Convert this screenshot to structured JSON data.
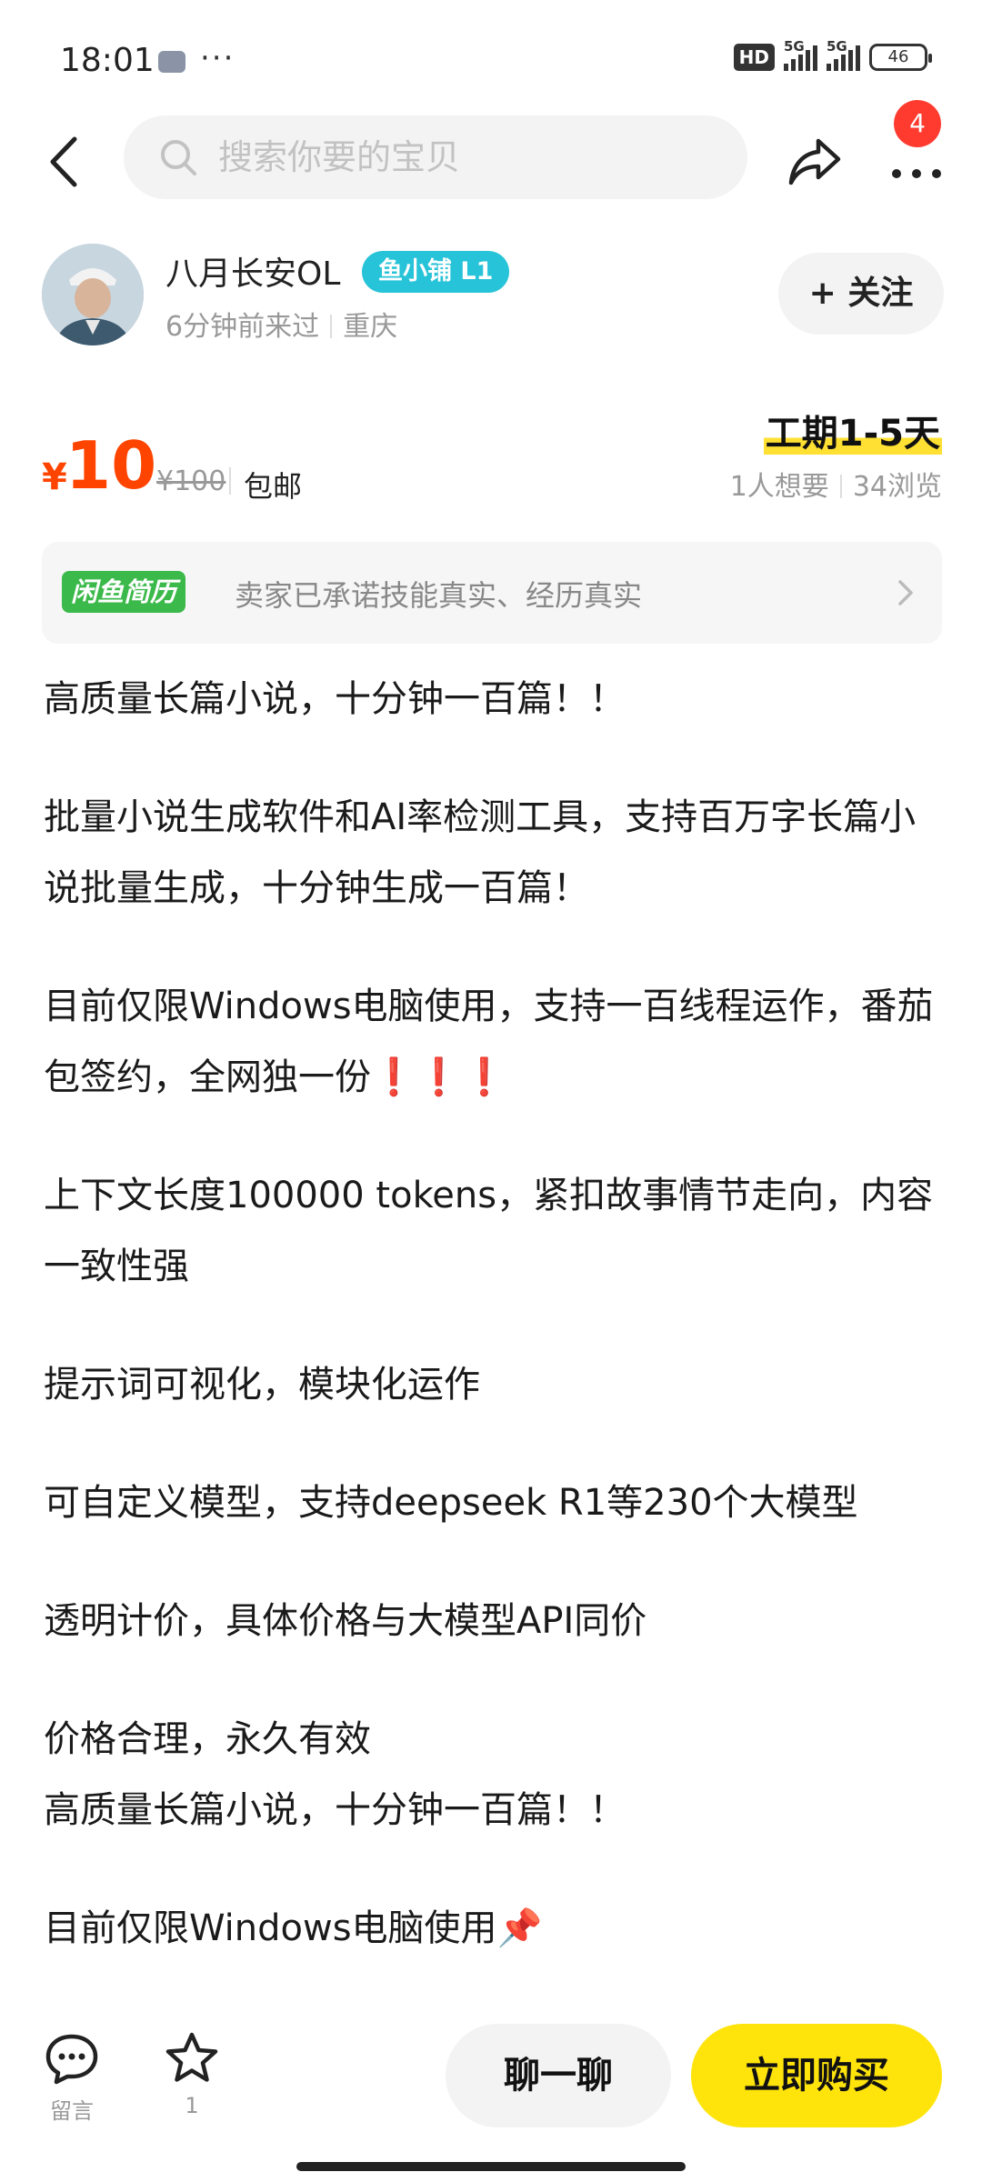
{
  "status_bar": {
    "time": "18:01",
    "dots": "···",
    "hd_label": "HD",
    "net1": "5G",
    "net2": "5G",
    "battery": "46"
  },
  "header": {
    "search_placeholder": "搜索你要的宝贝",
    "notification_count": "4"
  },
  "seller": {
    "name": "八月长安OL",
    "shop_badge": "鱼小铺 L1",
    "last_seen": "6分钟前来过",
    "location": "重庆",
    "follow_label": "+ 关注"
  },
  "price": {
    "currency": "¥",
    "value": "10",
    "original": "¥100",
    "shipping": "包邮",
    "duration": "工期1-5天",
    "wants": "1人想要",
    "views": "34浏览"
  },
  "resume_banner": {
    "logo": "闲鱼简历",
    "text": "卖家已承诺技能真实、经历真实"
  },
  "description": {
    "p1": "高质量长篇小说，十分钟一百篇！！",
    "p2": "批量小说生成软件和AI率检测工具，支持百万字长篇小说批量生成，十分钟生成一百篇！",
    "p3": "目前仅限Windows电脑使用，支持一百线程运作，番茄包签约，全网独一份",
    "p3_excl": "❗❗❗",
    "p4": "上下文长度100000 tokens，紧扣故事情节走向，内容一致性强",
    "p5": "提示词可视化，模块化运作",
    "p6": "可自定义模型，支持deepseek R1等230个大模型",
    "p7": "透明计价，具体价格与大模型API同价",
    "p8": "价格合理，永久有效",
    "p9": "高质量长篇小说，十分钟一百篇！！",
    "p10": "目前仅限Windows电脑使用",
    "p10_icon": "📌"
  },
  "bottom_bar": {
    "message_label": "留言",
    "favorite_count": "1",
    "chat_label": "聊一聊",
    "buy_label": "立即购买"
  },
  "colors": {
    "price": "#ff4400",
    "buy_button": "#ffe40c",
    "shop_badge": "#27c3d8",
    "resume_logo": "#3bb94a",
    "notification_badge": "#ff3b30"
  }
}
